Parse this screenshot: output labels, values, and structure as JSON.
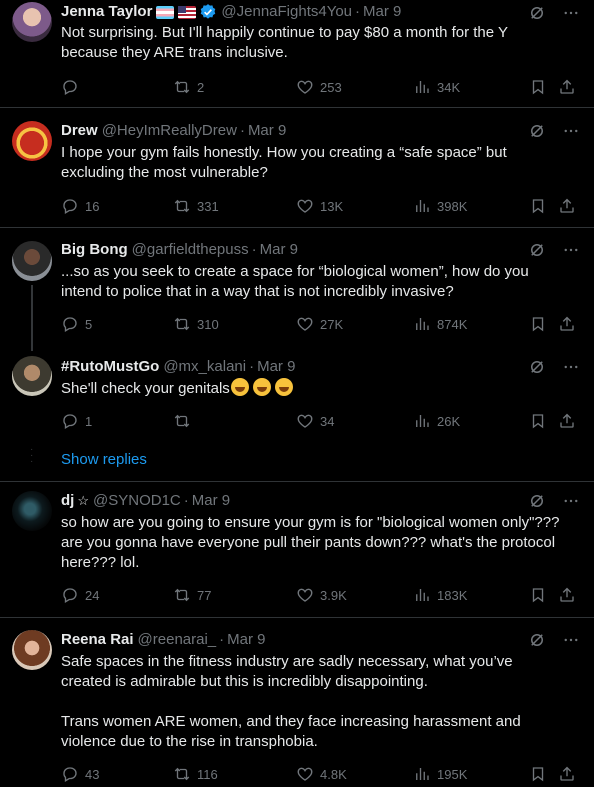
{
  "tweets": [
    {
      "name": "Jenna Taylor",
      "handle": "@JennaFights4You",
      "time": "Mar 9",
      "text": [
        "Not surprising. But I'll happily continue to pay $80 a month for the Y",
        "because they ARE trans inclusive."
      ],
      "replies": "",
      "retweets": "2",
      "likes": "253",
      "views": "34K",
      "verified": true
    },
    {
      "name": "Drew",
      "handle": "@HeyImReallyDrew",
      "time": "Mar 9",
      "text": [
        "I hope your gym fails honestly. How you creating a “safe space” but",
        "excluding the most vulnerable?"
      ],
      "replies": "16",
      "retweets": "331",
      "likes": "13K",
      "views": "398K"
    },
    {
      "name": "Big Bong",
      "handle": "@garfieldthepuss",
      "time": "Mar 9",
      "text": [
        "...so as you seek to create a space for “biological women”, how do you",
        "intend to police that in a way that is not incredibly invasive?"
      ],
      "replies": "5",
      "retweets": "310",
      "likes": "27K",
      "views": "874K"
    },
    {
      "name": "#RutoMustGo",
      "handle": "@mx_kalani",
      "time": "Mar 9",
      "text": [
        "She'll check your genitals"
      ],
      "replies": "1",
      "retweets": "",
      "likes": "34",
      "views": "26K"
    },
    {
      "name": "dj",
      "handle": "@SYNOD1C",
      "time": "Mar 9",
      "text": [
        "so how are you going to ensure your gym is for \"biological women only\"???",
        "are you gonna have everyone pull their pants down??? what's the protocol",
        "here??? lol."
      ],
      "replies": "24",
      "retweets": "77",
      "likes": "3.9K",
      "views": "183K"
    },
    {
      "name": "Reena Rai",
      "handle": "@reenarai_",
      "time": "Mar 9",
      "text": [
        "Safe spaces in the fitness industry are sadly necessary, what you’ve",
        "created is admirable but this is incredibly disappointing.",
        "",
        "Trans women ARE women, and they face increasing harassment and",
        "violence due to the rise in transphobia."
      ],
      "replies": "43",
      "retweets": "116",
      "likes": "4.8K",
      "views": "195K"
    }
  ],
  "show_replies": "Show replies",
  "colors": {
    "accent": "#1d9bf0",
    "muted": "#71767b",
    "divider": "#2f3336",
    "text": "#e7e9ea"
  }
}
